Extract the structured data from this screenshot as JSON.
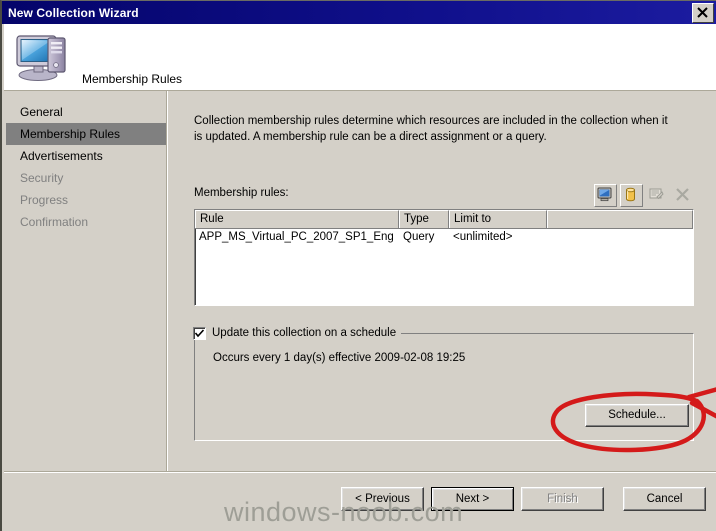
{
  "window": {
    "title": "New Collection Wizard",
    "close_icon": "close-icon"
  },
  "header": {
    "title": "Membership Rules",
    "icon": "computer-icon"
  },
  "sidebar": {
    "items": [
      {
        "label": "General",
        "state": "enabled"
      },
      {
        "label": "Membership Rules",
        "state": "selected"
      },
      {
        "label": "Advertisements",
        "state": "enabled"
      },
      {
        "label": "Security",
        "state": "disabled"
      },
      {
        "label": "Progress",
        "state": "disabled"
      },
      {
        "label": "Confirmation",
        "state": "disabled"
      }
    ]
  },
  "main": {
    "intro": "Collection membership rules determine which resources are included in the collection when it is updated. A membership rule can be a direct assignment or a query.",
    "rules_label": "Membership rules:",
    "toolbar": [
      {
        "name": "direct-rule-icon",
        "enabled": true
      },
      {
        "name": "query-rule-icon",
        "enabled": true
      },
      {
        "name": "properties-icon",
        "enabled": false
      },
      {
        "name": "delete-icon",
        "enabled": false
      }
    ],
    "table": {
      "columns": [
        "Rule",
        "Type",
        "Limit to",
        ""
      ],
      "rows": [
        [
          "APP_MS_Virtual_PC_2007_SP1_Eng",
          "Query",
          "<unlimited>",
          ""
        ]
      ]
    },
    "schedule": {
      "checkbox_label": "Update this collection on a schedule",
      "checked": true,
      "occurrence": "Occurs every 1 day(s) effective 2009-02-08 19:25",
      "button_label": "Schedule..."
    }
  },
  "footer": {
    "previous": "< Previous",
    "next": "Next >",
    "finish": "Finish",
    "cancel": "Cancel"
  },
  "watermark": "windows-noob.com",
  "colors": {
    "titlebar": "#0a246a",
    "face": "#d4d0c8",
    "selection": "#808080",
    "disabled_text": "#808080",
    "annotation": "#d41a1a"
  }
}
